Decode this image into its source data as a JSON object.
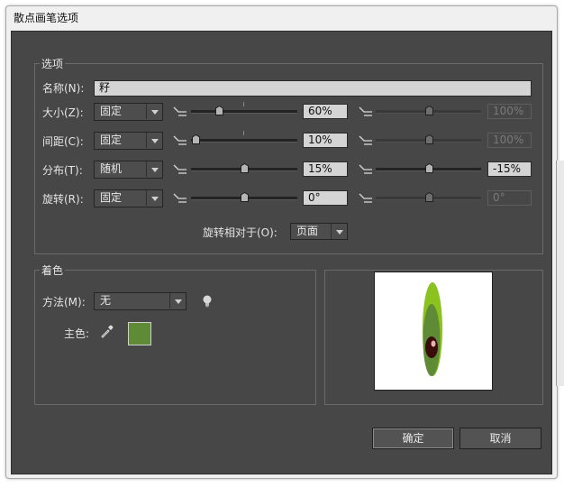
{
  "window": {
    "title": "散点画笔选项"
  },
  "options": {
    "legend": "选项",
    "name_label": "名称(N):",
    "name_value": "籽",
    "rows": [
      {
        "label": "大小(Z):",
        "mode": "固定",
        "min_value": "60%",
        "max_value": "100%",
        "min_fraction": 0.26,
        "max_fraction": 0.5,
        "max_enabled": false
      },
      {
        "label": "间距(C):",
        "mode": "固定",
        "min_value": "10%",
        "max_value": "100%",
        "min_fraction": 0.04,
        "max_fraction": 0.5,
        "max_enabled": false
      },
      {
        "label": "分布(T):",
        "mode": "随机",
        "min_value": "15%",
        "max_value": "-15%",
        "min_fraction": 0.5,
        "max_fraction": 0.5,
        "max_enabled": true
      },
      {
        "label": "旋转(R):",
        "mode": "固定",
        "min_value": "0°",
        "max_value": "0°",
        "min_fraction": 0.5,
        "max_fraction": 0.5,
        "max_enabled": false
      }
    ],
    "rotation_relative_label": "旋转相对于(O):",
    "rotation_relative_value": "页面"
  },
  "colorization": {
    "legend": "着色",
    "method_label": "方法(M):",
    "method_value": "无",
    "key_color_label": "主色:",
    "key_color": "#5f8a36",
    "tips_icon": "lightbulb-icon",
    "eyedropper_icon": "eyedropper-icon"
  },
  "preview": {
    "shape": "seed",
    "colors": {
      "outer": "#8cc21f",
      "inner": "#5f8a36",
      "eye": "#3a0d0b"
    }
  },
  "buttons": {
    "ok": "确定",
    "cancel": "取消"
  },
  "icons": {
    "variation": "variation-icon",
    "thumb": "slider-thumb-icon"
  }
}
